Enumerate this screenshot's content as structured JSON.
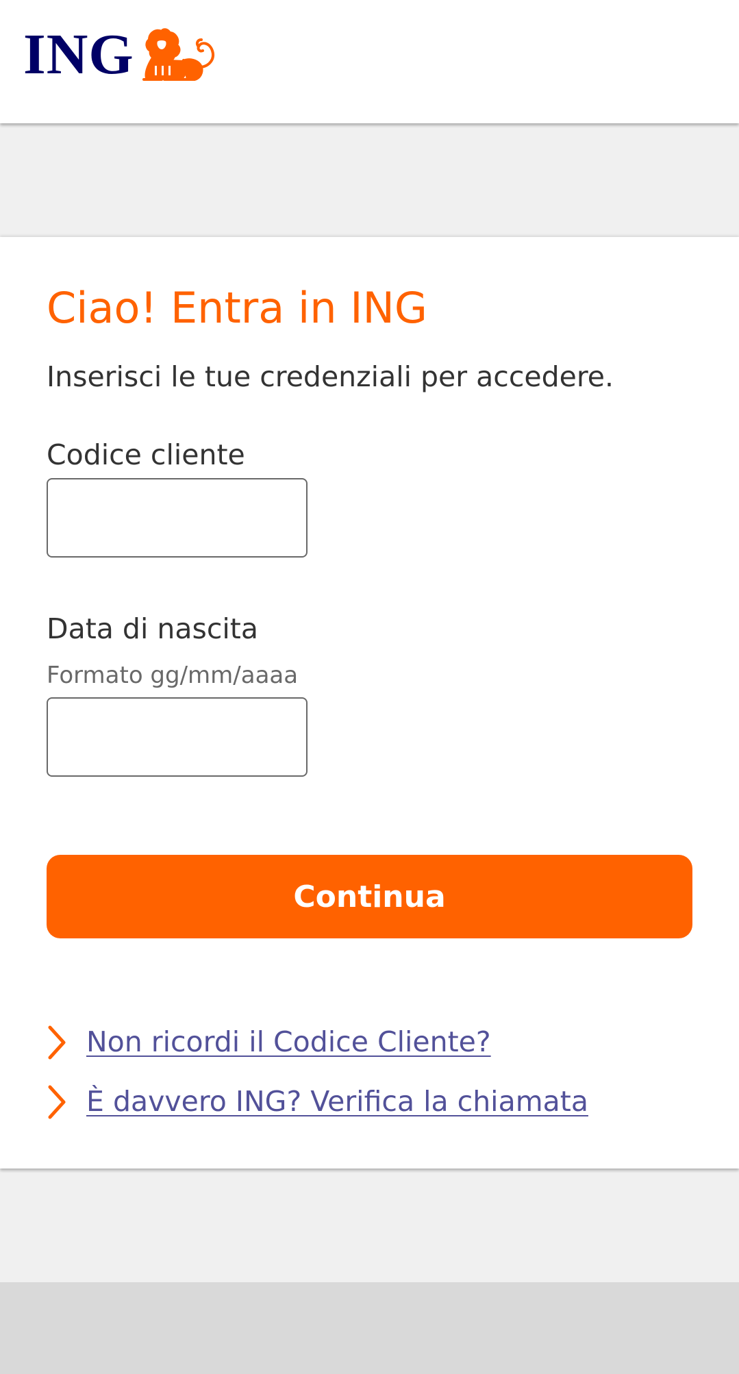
{
  "header": {
    "logo_text": "ING",
    "logo_icon": "lion-icon"
  },
  "colors": {
    "brand_orange": "#ff6200",
    "brand_navy": "#000066",
    "link": "#525199",
    "text": "#333333",
    "muted": "#696969"
  },
  "login": {
    "title": "Ciao! Entra in ING",
    "subtitle": "Inserisci le tue credenziali per accedere.",
    "customer_code": {
      "label": "Codice cliente",
      "value": "",
      "placeholder": ""
    },
    "birth_date": {
      "label": "Data di nascita",
      "hint": "Formato gg/mm/aaaa",
      "value": "",
      "placeholder": ""
    },
    "continue_label": "Continua",
    "links": [
      {
        "label": "Non ricordi il Codice Cliente?",
        "icon": "chevron-right-icon"
      },
      {
        "label": "È davvero ING? Verifica la chiamata",
        "icon": "chevron-right-icon"
      }
    ]
  }
}
